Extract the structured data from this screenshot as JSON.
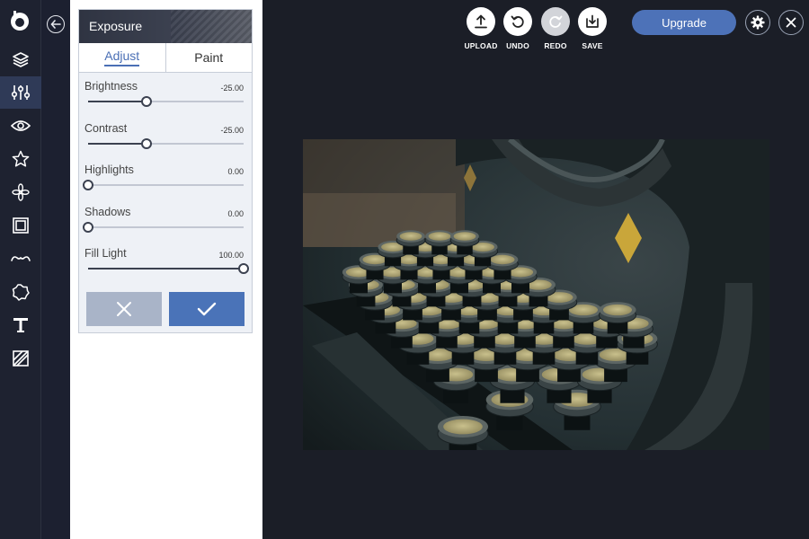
{
  "editor": {
    "panel_title": "Exposure",
    "tabs": [
      {
        "label": "Adjust",
        "active": true
      },
      {
        "label": "Paint",
        "active": false
      }
    ],
    "sliders": [
      {
        "name": "Brightness",
        "value": "-25.00",
        "position": 0.375
      },
      {
        "name": "Contrast",
        "value": "-25.00",
        "position": 0.375
      },
      {
        "name": "Highlights",
        "value": "0.00",
        "position": 0.0
      },
      {
        "name": "Shadows",
        "value": "0.00",
        "position": 0.0
      },
      {
        "name": "Fill Light",
        "value": "100.00",
        "position": 1.0
      }
    ]
  },
  "toolbar": {
    "upload": "UPLOAD",
    "undo": "UNDO",
    "redo": "REDO",
    "save": "SAVE",
    "upgrade": "Upgrade"
  },
  "rail": {
    "items": [
      {
        "icon": "layers-icon"
      },
      {
        "icon": "adjustments-icon",
        "active": true
      },
      {
        "icon": "eye-icon"
      },
      {
        "icon": "star-icon"
      },
      {
        "icon": "flower-icon"
      },
      {
        "icon": "frame-icon"
      },
      {
        "icon": "mustache-icon"
      },
      {
        "icon": "shape-icon"
      },
      {
        "icon": "text-icon"
      },
      {
        "icon": "texture-icon"
      }
    ]
  },
  "colors": {
    "accent": "#4a73b8",
    "background": "#1b1e27",
    "rail": "#1e2230",
    "panel": "#ffffff"
  }
}
